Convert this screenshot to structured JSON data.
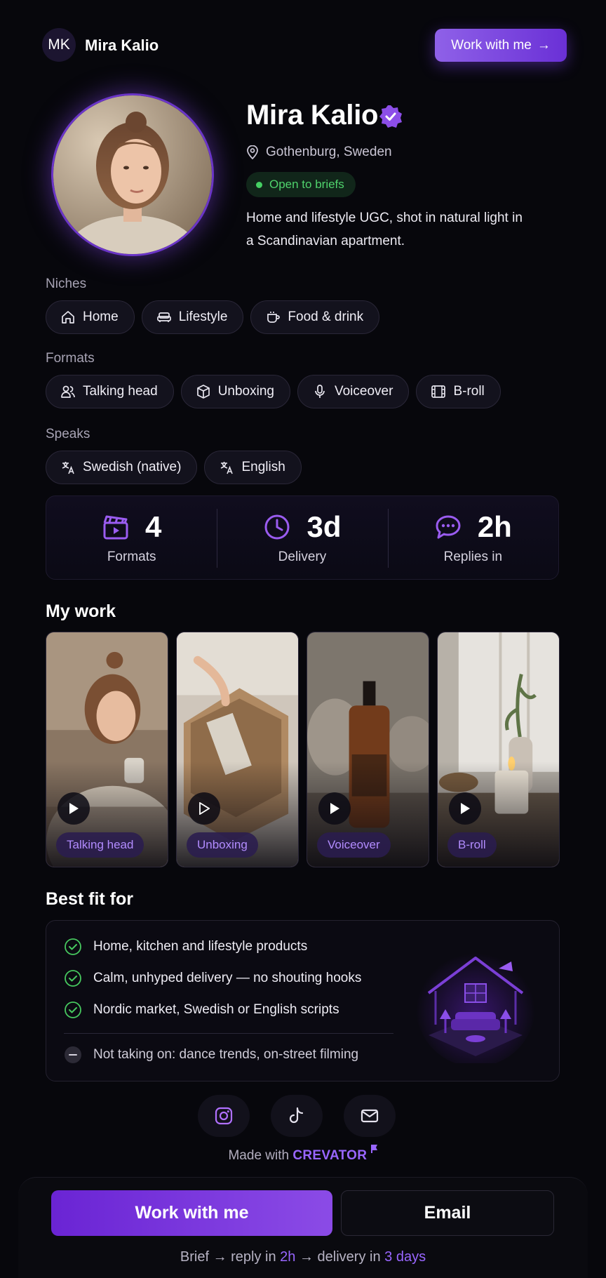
{
  "header": {
    "initials": "MK",
    "name": "Mira Kalio",
    "cta_label": "Work with me",
    "cta_arrow": "→"
  },
  "profile": {
    "name": "Mira Kalio",
    "location": "Gothenburg, Sweden",
    "status": "Open to briefs",
    "bio": "Home and lifestyle UGC, shot in natural light in a Scandinavian apartment.",
    "status_color": "#4fd26c",
    "accent": "#8b4be6"
  },
  "niches": {
    "label": "Niches",
    "items": [
      {
        "label": "Home",
        "icon": "home-icon"
      },
      {
        "label": "Lifestyle",
        "icon": "sofa-icon"
      },
      {
        "label": "Food & drink",
        "icon": "cup-icon"
      }
    ]
  },
  "formats": {
    "label": "Formats",
    "items": [
      {
        "label": "Talking head",
        "icon": "users-icon"
      },
      {
        "label": "Unboxing",
        "icon": "box-icon"
      },
      {
        "label": "Voiceover",
        "icon": "mic-icon"
      },
      {
        "label": "B-roll",
        "icon": "film-icon"
      }
    ]
  },
  "languages": {
    "label": "Speaks",
    "items": [
      {
        "label": "Swedish (native)",
        "icon": "translate-icon"
      },
      {
        "label": "English",
        "icon": "translate-icon"
      }
    ]
  },
  "stats": [
    {
      "value": "4",
      "label": "Formats",
      "icon": "clapperboard-icon"
    },
    {
      "value": "3d",
      "label": "Delivery",
      "icon": "clock-icon"
    },
    {
      "value": "2h",
      "label": "Replies in",
      "icon": "chat-icon"
    }
  ],
  "work": {
    "title": "My work",
    "items": [
      {
        "tag": "Talking head"
      },
      {
        "tag": "Unboxing"
      },
      {
        "tag": "Voiceover"
      },
      {
        "tag": "B-roll"
      }
    ]
  },
  "best_fit": {
    "title": "Best fit for",
    "items": [
      "Home, kitchen and lifestyle products",
      "Calm, unhyped delivery — no shouting hooks",
      "Nordic market, Swedish or English scripts"
    ],
    "not_taking": "Not taking on: dance trends, on-street filming"
  },
  "socials": [
    {
      "icon": "instagram-icon"
    },
    {
      "icon": "tiktok-icon"
    },
    {
      "icon": "mail-icon"
    }
  ],
  "footer": {
    "made_with": "Made with",
    "brand": "CREVATOR"
  },
  "actions": {
    "primary": "Work with me",
    "secondary": "Email",
    "flow_brief": "Brief → reply in",
    "flow_reply": "2h",
    "flow_mid": "→ delivery in",
    "flow_delivery": "3 days"
  }
}
